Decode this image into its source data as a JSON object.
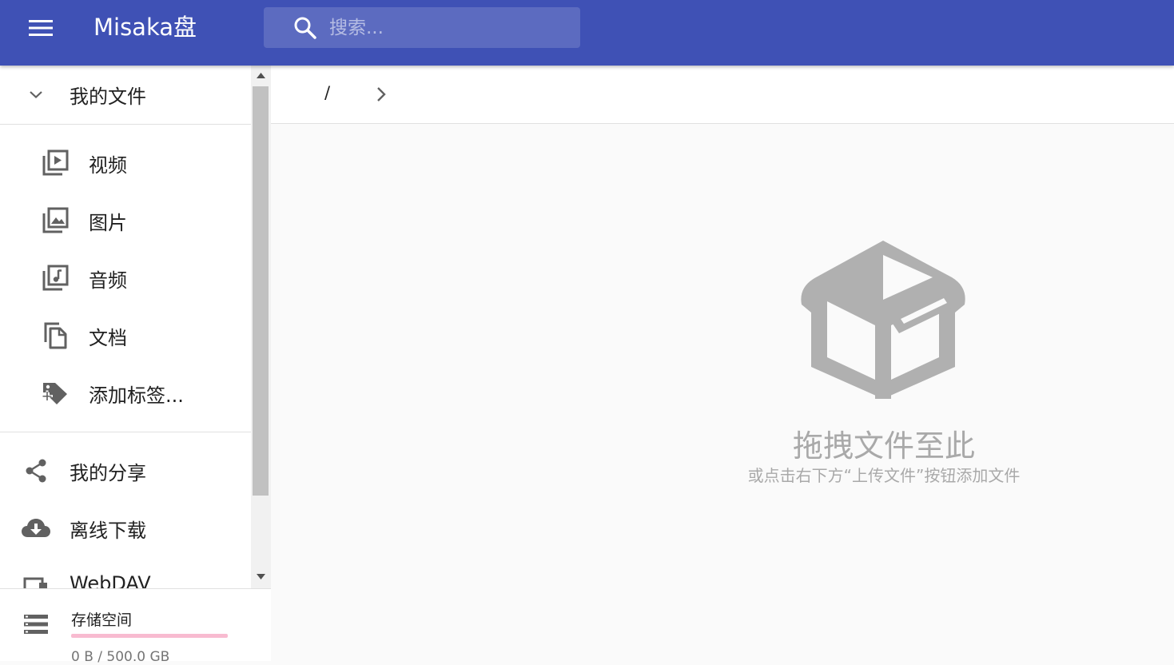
{
  "app": {
    "title": "Misaka盘"
  },
  "search": {
    "placeholder": "搜索..."
  },
  "sidebar": {
    "my_files": "我的文件",
    "categories": [
      {
        "icon": "video-library-icon",
        "label": "视频"
      },
      {
        "icon": "photo-library-icon",
        "label": "图片"
      },
      {
        "icon": "music-library-icon",
        "label": "音频"
      },
      {
        "icon": "document-copy-icon",
        "label": "文档"
      },
      {
        "icon": "add-tag-icon",
        "label": "添加标签..."
      }
    ],
    "my_share": "我的分享",
    "offline_download": "离线下载",
    "webdav": "WebDAV"
  },
  "storage": {
    "title": "存储空间",
    "usage": "0 B / 500.0 GB",
    "used_fraction": 0
  },
  "breadcrumb": {
    "root": "/"
  },
  "empty_state": {
    "title": "拖拽文件至此",
    "subtitle": "或点击右下方“上传文件”按钮添加文件"
  },
  "colors": {
    "primary": "#3f51b5",
    "search_bg": "#5c6bc0",
    "storage_bar": "#f48fb1",
    "empty_icon": "#b0b0b0"
  }
}
